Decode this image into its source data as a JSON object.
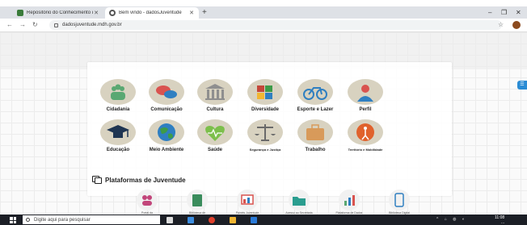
{
  "browser": {
    "tabs": [
      {
        "title": "Repositório do Conhecimento d...",
        "active": false
      },
      {
        "title": "Bem vindo - dadosJuventude",
        "active": true
      }
    ],
    "new_tab_symbol": "+",
    "window_controls": {
      "minimize": "–",
      "restore": "❐",
      "close": "✕"
    },
    "nav": {
      "back": "←",
      "forward": "→",
      "reload": "↻"
    },
    "url": "dadosjuventude.mdh.gov.br",
    "star": "☆"
  },
  "categories": [
    {
      "label": "Cidadania",
      "icon": "people-group-icon",
      "color": "#5aa872"
    },
    {
      "label": "Comunicação",
      "icon": "speech-bubbles-icon",
      "color": "#d9534f"
    },
    {
      "label": "Cultura",
      "icon": "museum-icon",
      "color": "#8f8f8f"
    },
    {
      "label": "Diversidade",
      "icon": "diversity-puzzle-icon",
      "color": "#c4473a"
    },
    {
      "label": "Esporte e Lazer",
      "icon": "bicycle-icon",
      "color": "#2f7fc1"
    },
    {
      "label": "Perfil",
      "icon": "profile-silhouette-icon",
      "color": "#d9534f"
    },
    {
      "label": "Educação",
      "icon": "graduation-cap-icon",
      "color": "#1f3552"
    },
    {
      "label": "Meio Ambiente",
      "icon": "earth-globe-icon",
      "color": "#3e9b48"
    },
    {
      "label": "Saúde",
      "icon": "heart-health-icon",
      "color": "#7cbf4b"
    },
    {
      "label": "Segurança e Justiça",
      "icon": "scales-of-justice-icon",
      "color": "#6a6a6a"
    },
    {
      "label": "Trabalho",
      "icon": "briefcase-icon",
      "color": "#d89a5a"
    },
    {
      "label": "Território e Mobilidade",
      "icon": "mobility-sign-icon",
      "color": "#e0622c"
    }
  ],
  "platforms": {
    "title": "Plataformas de Juventude",
    "items": [
      {
        "label": "Portal da",
        "icon": "people-icon",
        "color": "#c2457a"
      },
      {
        "label": "Biblioteca de",
        "icon": "book-icon",
        "color": "#3a8c5c"
      },
      {
        "label": "Painéis Juventude",
        "icon": "dashboard-icon",
        "color": "#d9534f"
      },
      {
        "label": "Acesso ao Secretaria",
        "icon": "folder-icon",
        "color": "#2a9d8f"
      },
      {
        "label": "Plataforma de Dados",
        "icon": "bar-chart-icon",
        "color": "#5aa872"
      },
      {
        "label": "Biblioteca Digital",
        "icon": "tablet-icon",
        "color": "#2f7fc1"
      }
    ]
  },
  "side_tab": "☰",
  "taskbar": {
    "search_placeholder": "Digite aqui para pesquisar",
    "tray": "^ ⌂ ◍ ◐",
    "time": "11:08",
    "date": "..."
  }
}
